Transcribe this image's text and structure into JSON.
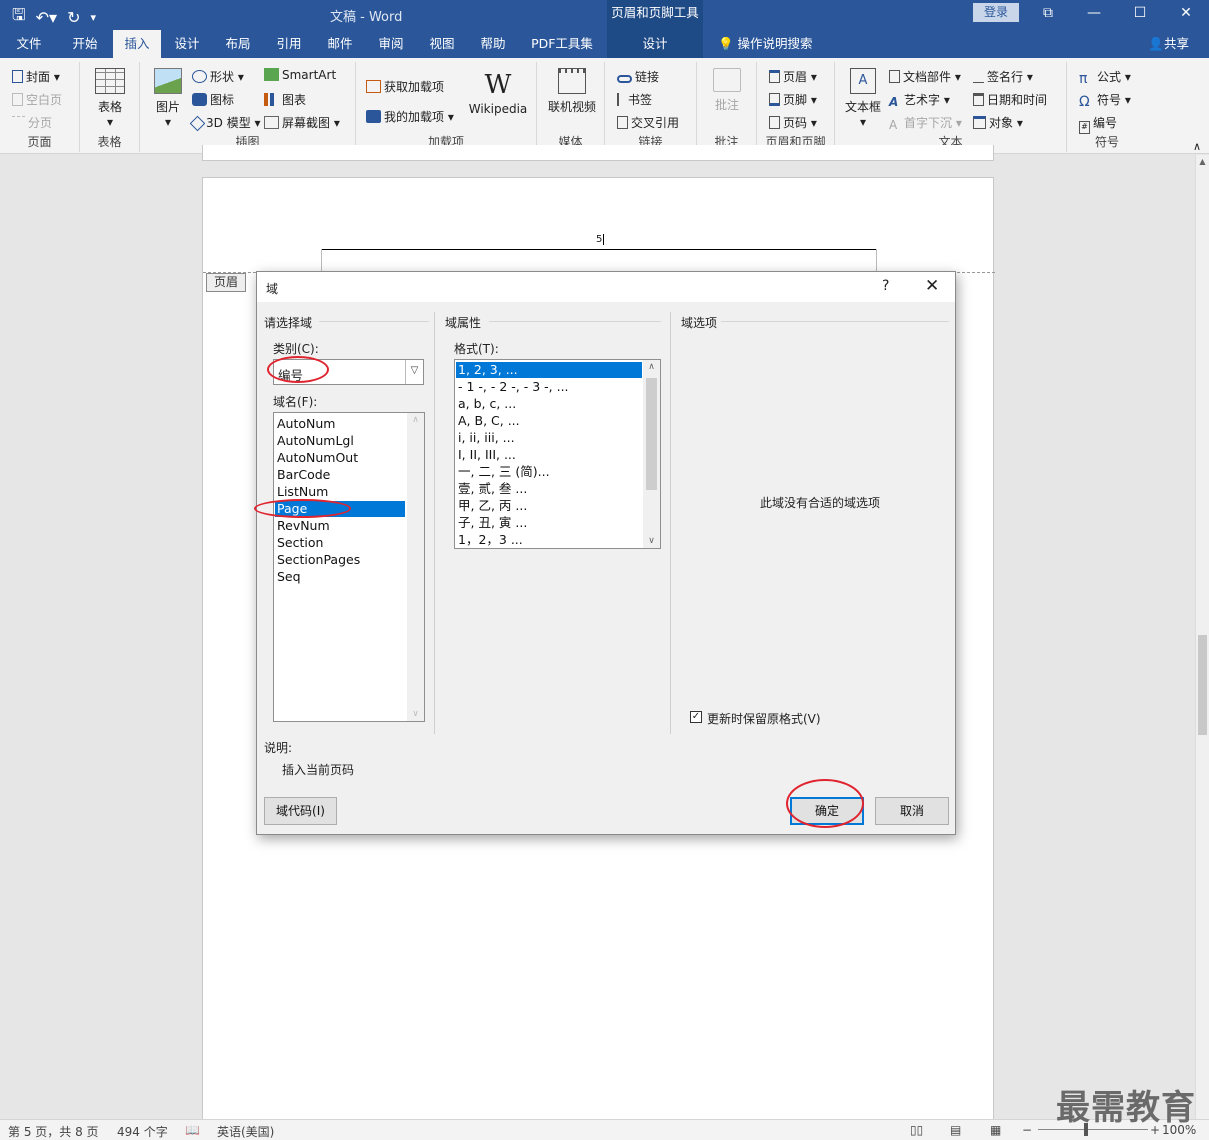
{
  "titlebar": {
    "doc_title": "文稿  -  Word",
    "context_tools": "页眉和页脚工具",
    "login": "登录"
  },
  "tabs": [
    "文件",
    "开始",
    "插入",
    "设计",
    "布局",
    "引用",
    "邮件",
    "审阅",
    "视图",
    "帮助",
    "PDF工具集",
    "设计"
  ],
  "tell_me": "操作说明搜索",
  "share": "共享",
  "ribbon": {
    "page_group": {
      "cover": "封面",
      "blank": "空白页",
      "break": "分页",
      "label": "页面"
    },
    "table_group": {
      "table": "表格",
      "label": "表格"
    },
    "illus_group": {
      "picture": "图片",
      "shapes": "形状",
      "icons": "图标",
      "model3d": "3D 模型",
      "smartart": "SmartArt",
      "chart": "图表",
      "screenshot": "屏幕截图",
      "label": "插图"
    },
    "addin_group": {
      "get": "获取加载项",
      "my": "我的加载项",
      "wiki": "Wikipedia",
      "label": "加载项"
    },
    "media_group": {
      "video": "联机视频",
      "label": "媒体"
    },
    "link_group": {
      "link": "链接",
      "bookmark": "书签",
      "xref": "交叉引用",
      "label": "链接"
    },
    "comment_group": {
      "comment": "批注",
      "label": "批注"
    },
    "hf_group": {
      "header": "页眉",
      "footer": "页脚",
      "pagenum": "页码",
      "label": "页眉和页脚"
    },
    "text_group": {
      "textbox": "文本框",
      "quickparts": "文档部件",
      "wordart": "艺术字",
      "dropcap": "首字下沉",
      "sigline": "签名行",
      "datetime": "日期和时间",
      "object": "对象",
      "label": "文本"
    },
    "symbol_group": {
      "equation": "公式",
      "symbol": "符号",
      "number": "编号",
      "label": "符号"
    }
  },
  "document": {
    "header_text": "5",
    "header_tag": "页眉"
  },
  "dialog": {
    "title": "域",
    "help": "?",
    "select_field": "请选择域",
    "category_label": "类别(C):",
    "category_value": "编号",
    "fieldnames_label": "域名(F):",
    "fieldnames": [
      "AutoNum",
      "AutoNumLgl",
      "AutoNumOut",
      "BarCode",
      "ListNum",
      "Page",
      "RevNum",
      "Section",
      "SectionPages",
      "Seq"
    ],
    "selected_field": "Page",
    "props_title": "域属性",
    "format_label": "格式(T):",
    "formats": [
      "1, 2, 3, ...",
      "- 1 -, - 2 -, - 3 -, ...",
      "a, b, c, ...",
      "A, B, C, ...",
      "i, ii, iii, ...",
      "I, II, III, ...",
      "一, 二, 三 (简)...",
      "壹, 贰, 叁 ...",
      "甲, 乙, 丙 ...",
      "子, 丑, 寅 ...",
      "1，2，3 ..."
    ],
    "options_title": "域选项",
    "no_options": "此域没有合适的域选项",
    "preserve_label": "更新时保留原格式(V)",
    "preserve_checked": true,
    "desc_label": "说明:",
    "desc_text": "插入当前页码",
    "field_codes_btn": "域代码(I)",
    "ok_btn": "确定",
    "cancel_btn": "取消"
  },
  "status": {
    "page": "第 5 页，共 8 页",
    "words": "494 个字",
    "lang": "英语(美国)",
    "zoom": "100%"
  },
  "watermark": "最需教育"
}
